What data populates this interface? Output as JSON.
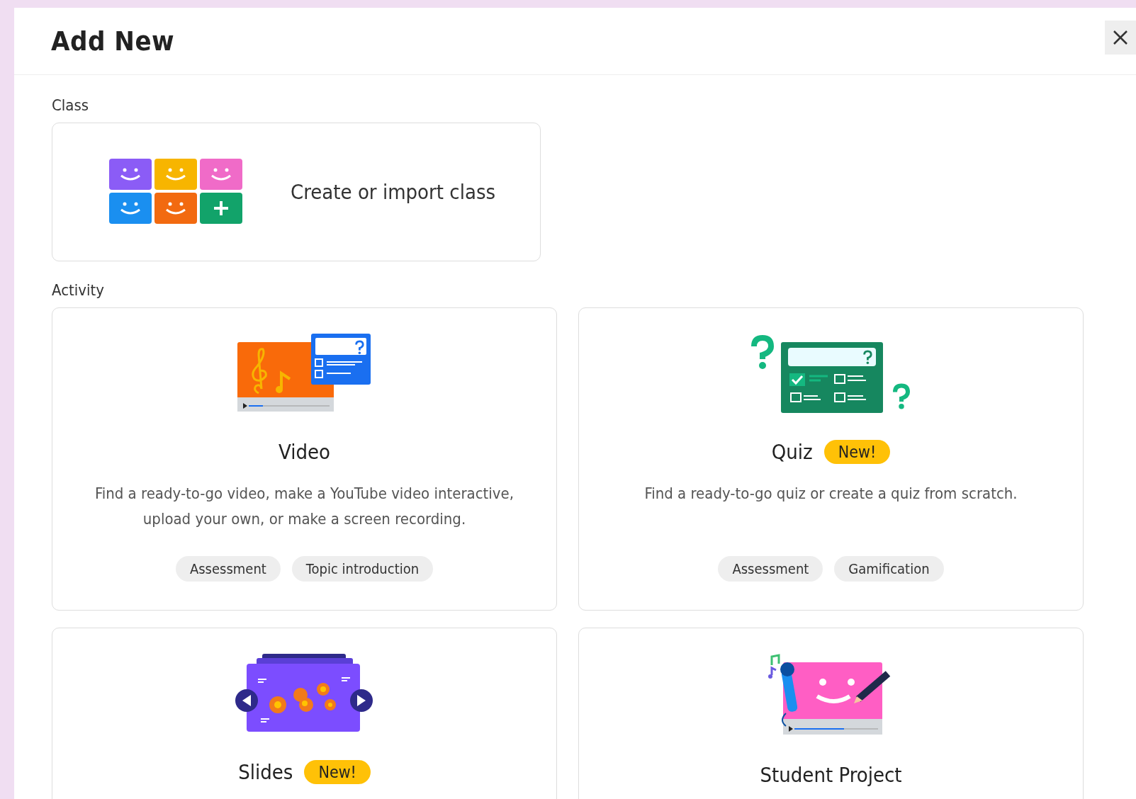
{
  "dialog": {
    "title": "Add New"
  },
  "class_section": {
    "heading": "Class",
    "card": {
      "label": "Create or import class"
    }
  },
  "activity_section": {
    "heading": "Activity",
    "cards": [
      {
        "kind": "video",
        "title": "Video",
        "description": "Find a ready-to-go video, make a YouTube video interactive, upload your own, or make a screen recording.",
        "tags": [
          "Assessment",
          "Topic introduction"
        ]
      },
      {
        "kind": "quiz",
        "title": "Quiz",
        "badge": "New!",
        "description": "Find a ready-to-go quiz or create a quiz from scratch.",
        "tags": [
          "Assessment",
          "Gamification"
        ]
      },
      {
        "kind": "slides",
        "title": "Slides",
        "badge": "New!"
      },
      {
        "kind": "project",
        "title": "Student Project"
      }
    ]
  }
}
